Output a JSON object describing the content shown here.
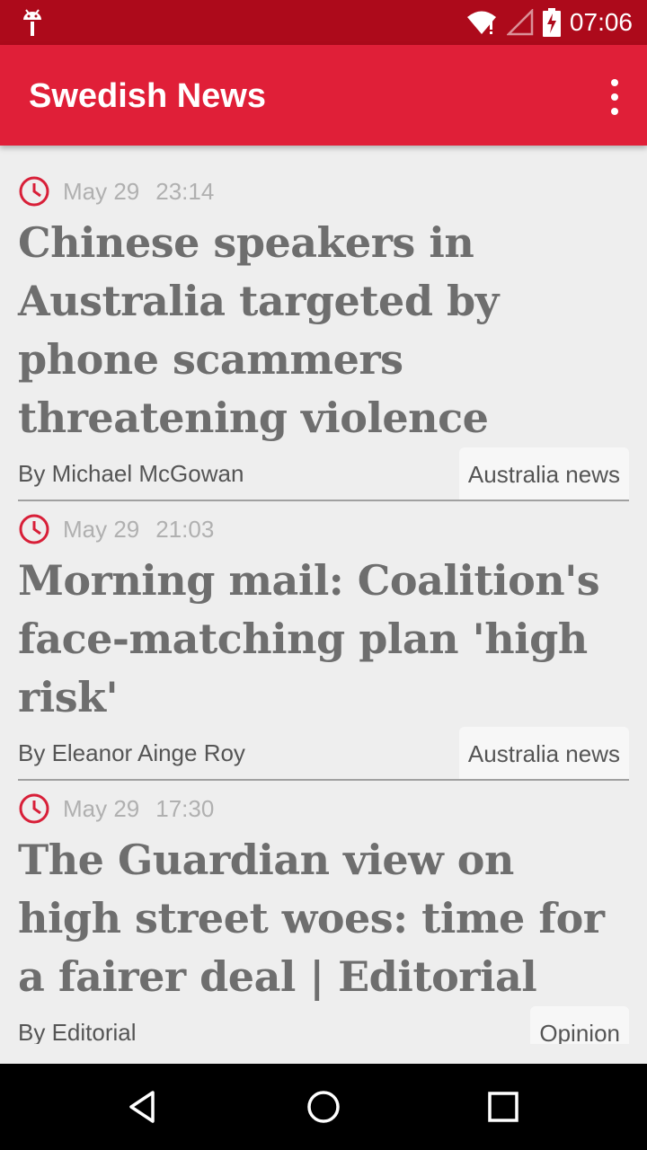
{
  "status_bar": {
    "time": "07:06"
  },
  "app_bar": {
    "title": "Swedish News"
  },
  "articles": [
    {
      "date": "May 29",
      "time": "23:14",
      "headline": "Chinese speakers in Australia targeted by phone scammers threatening violence",
      "byline": "By Michael McGowan",
      "category": "Australia news"
    },
    {
      "date": "May 29",
      "time": "21:03",
      "headline": "Morning mail: Coalition's face-matching plan 'high risk'",
      "byline": "By Eleanor Ainge Roy",
      "category": "Australia news"
    },
    {
      "date": "May 29",
      "time": "17:30",
      "headline": "The Guardian view on high street woes: time for a fairer deal | Editorial",
      "byline": "By Editorial",
      "category": "Opinion"
    }
  ],
  "colors": {
    "status_bar": "#ad0a1b",
    "app_bar": "#e01f38",
    "accent": "#d81f38",
    "background": "#eeeeee"
  },
  "icons": [
    "android-icon",
    "wifi-icon",
    "signal-icon",
    "battery-charging-icon",
    "more-vert-icon",
    "clock-icon",
    "back-icon",
    "home-icon",
    "recents-icon"
  ]
}
